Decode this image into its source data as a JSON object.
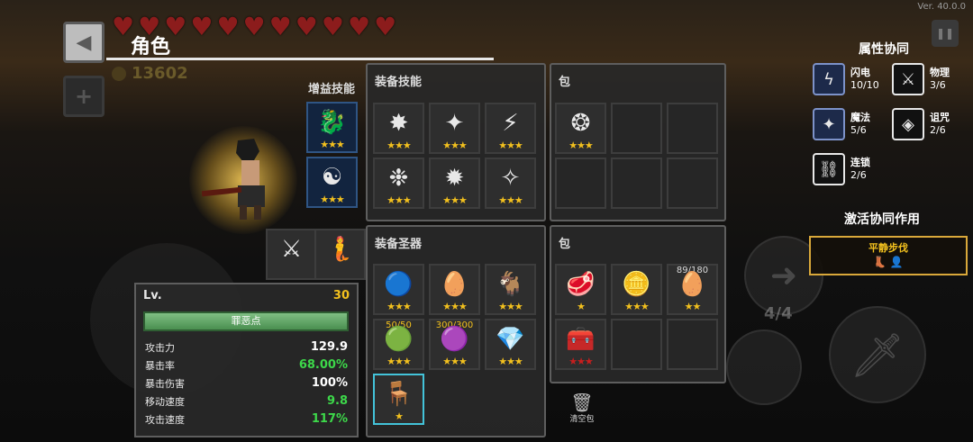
{
  "version": "Ver. 40.0.0",
  "header": {
    "title": "角色",
    "gold": "13602",
    "back_icon": "◀",
    "plus_icon": "+",
    "pause_icon": "❚❚",
    "hearts_count": 11
  },
  "character": {
    "sprite": "swordsman"
  },
  "buff_skills": {
    "title": "增益技能",
    "slots": [
      {
        "icon": "🐉",
        "stars": "★★★"
      },
      {
        "icon": "☯",
        "stars": "★★★"
      }
    ]
  },
  "weapons": [
    {
      "icon": "⚔"
    },
    {
      "icon": "🧜"
    }
  ],
  "equip_skills": {
    "title": "装备技能",
    "slots": [
      {
        "icon": "✸",
        "stars": "★★★"
      },
      {
        "icon": "✦",
        "stars": "★★★"
      },
      {
        "icon": "⚡",
        "stars": "★★★"
      },
      {
        "icon": "❉",
        "stars": "★★★"
      },
      {
        "icon": "✹",
        "stars": "★★★"
      },
      {
        "icon": "✧",
        "stars": "★★★"
      }
    ]
  },
  "skill_bag": {
    "title": "包",
    "slots": [
      {
        "icon": "❂",
        "stars": "★★★"
      }
    ]
  },
  "equip_relics": {
    "title": "装备圣器",
    "slots": [
      {
        "icon": "🔵",
        "stars": "★★★",
        "top": ""
      },
      {
        "icon": "🥚",
        "stars": "★★★",
        "top": ""
      },
      {
        "icon": "🐐",
        "stars": "★★★",
        "top": ""
      },
      {
        "icon": "🟢",
        "stars": "★★★",
        "top": "50/50"
      },
      {
        "icon": "🟣",
        "stars": "★★★",
        "top": "300/300"
      },
      {
        "icon": "💎",
        "stars": "★★★",
        "top": ""
      },
      {
        "icon": "🪑",
        "stars": "★",
        "top": ""
      }
    ]
  },
  "relic_bag": {
    "title": "包",
    "slots": [
      {
        "icon": "🥩",
        "stars": "★",
        "top": "",
        "red": false
      },
      {
        "icon": "🪙",
        "stars": "★★★",
        "top": "",
        "red": false
      },
      {
        "icon": "🥚",
        "stars": "★★",
        "top": "89/180",
        "red": false
      },
      {
        "icon": "🧰",
        "stars": "★★★",
        "top": "",
        "red": true
      }
    ],
    "clear_label": "清空包",
    "clear_icon": "🗑"
  },
  "stats": {
    "level_label": "Lv.",
    "level_value": "30",
    "button_label": "罪恶点",
    "rows": [
      {
        "label": "攻击力",
        "value": "129.9",
        "color": "#ffffff"
      },
      {
        "label": "暴击率",
        "value": "68.00%",
        "color": "#3dd94a"
      },
      {
        "label": "暴击伤害",
        "value": "100%",
        "color": "#ffffff"
      },
      {
        "label": "移动速度",
        "value": "9.8",
        "color": "#3dd94a"
      },
      {
        "label": "攻击速度",
        "value": "117%",
        "color": "#3dd94a"
      }
    ]
  },
  "synergy": {
    "title": "属性协同",
    "items": [
      {
        "name": "闪电",
        "count": "10/10",
        "icon": "ϟ",
        "active": true
      },
      {
        "name": "物理",
        "count": "3/6",
        "icon": "⚔",
        "active": false
      },
      {
        "name": "魔法",
        "count": "5/6",
        "icon": "✦",
        "active": true
      },
      {
        "name": "诅咒",
        "count": "2/6",
        "icon": "◈",
        "active": false
      },
      {
        "name": "连锁",
        "count": "2/6",
        "icon": "⛓",
        "active": false
      }
    ],
    "active_title": "激活协同作用",
    "active_effect": "平静步伐"
  },
  "controls": {
    "skill_count": "4/4"
  }
}
